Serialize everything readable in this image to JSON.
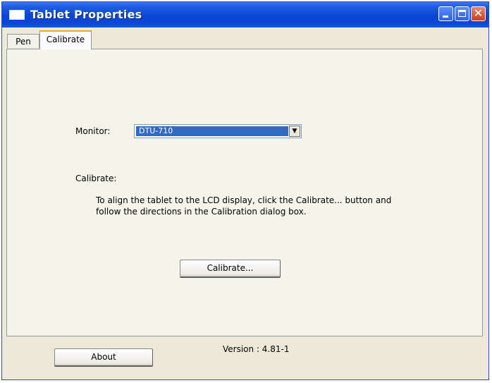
{
  "window": {
    "title": "Tablet Properties",
    "close_glyph": "✕"
  },
  "tabs": [
    {
      "label": "Pen",
      "selected": false
    },
    {
      "label": "Calibrate",
      "selected": true
    }
  ],
  "calibrate_panel": {
    "monitor_label": "Monitor:",
    "monitor_selected": "DTU-710",
    "dropdown_arrow": "▼",
    "heading": "Calibrate:",
    "description": "To align the tablet to the LCD display, click the Calibrate... button and follow the directions in the Calibration dialog box.",
    "calibrate_button": "Calibrate..."
  },
  "footer": {
    "about_button": "About",
    "version": "Version : 4.81-1"
  },
  "colors": {
    "title_bar": "#0a46d3",
    "selection": "#316ac5",
    "window_bg": "#ece9d8"
  }
}
